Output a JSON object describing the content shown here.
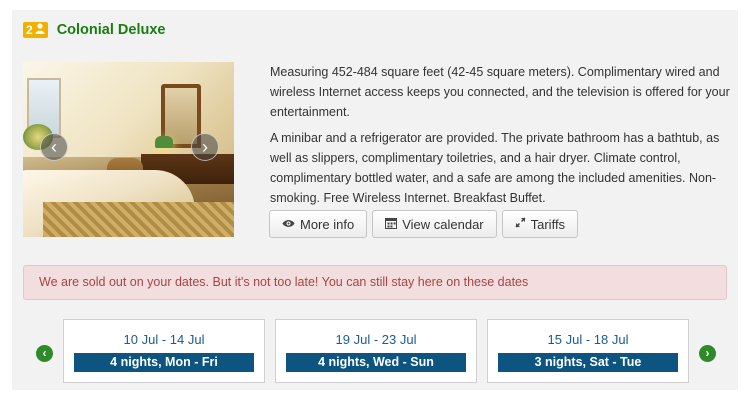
{
  "room": {
    "occupancy_count": "2",
    "occupancy_icon": "person-icon",
    "title": "Colonial Deluxe",
    "title_color": "#1a7d11",
    "badge_color": "#f0b000"
  },
  "gallery": {
    "prev_icon": "chevron-left-icon",
    "next_icon": "chevron-right-icon"
  },
  "description": {
    "paragraph1": "Measuring 452-484 square feet (42-45 square meters). Complimentary wired and wireless Internet access keeps you connected, and the television is offered for your entertainment.",
    "paragraph2": "A minibar and a refrigerator are provided. The private bathroom has a bathtub, as well as slippers, complimentary toiletries, and a hair dryer. Climate control, complimentary bottled water, and a safe are among the included amenities. Non-smoking. Free Wireless Internet. Breakfast Buffet."
  },
  "actions": {
    "more_info": {
      "label": "More info",
      "icon": "eye-icon"
    },
    "view_calendar": {
      "label": "View calendar",
      "icon": "calendar-icon"
    },
    "tariffs": {
      "label": "Tariffs",
      "icon": "resize-icon"
    }
  },
  "alert": {
    "message": "We are sold out on your dates. But it's not too late! You can still stay here on these dates",
    "color": "#a94442"
  },
  "alternatives": {
    "prev_icon": "circle-chevron-left-icon",
    "next_icon": "circle-chevron-right-icon",
    "items": [
      {
        "range": "10 Jul - 14 Jul",
        "nights": "4 nights, Mon - Fri"
      },
      {
        "range": "19 Jul - 23 Jul",
        "nights": "4 nights, Wed - Sun"
      },
      {
        "range": "15 Jul - 18 Jul",
        "nights": "3 nights, Sat - Tue"
      }
    ]
  }
}
